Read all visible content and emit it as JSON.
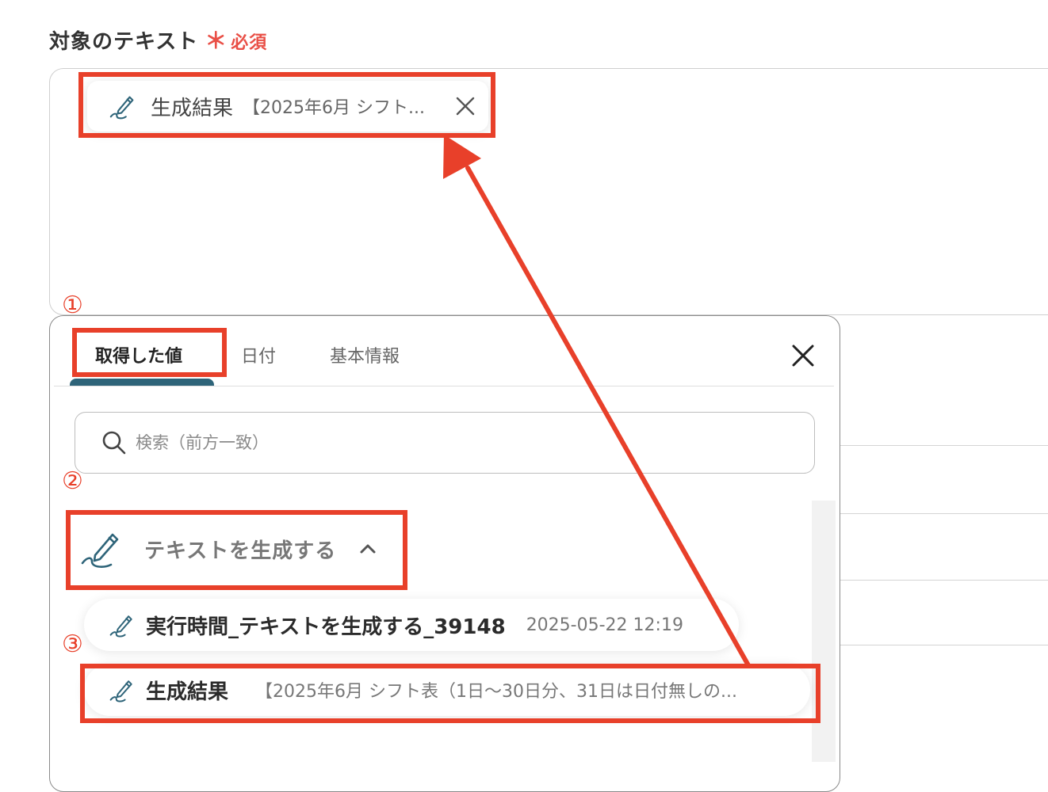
{
  "field": {
    "label": "対象のテキスト",
    "required_mark": "＊",
    "required_text": "必須"
  },
  "chip": {
    "icon": "pen-wave-icon",
    "name": "生成結果",
    "value": "【2025年6月 シフト..."
  },
  "panel": {
    "tabs": [
      {
        "label": "取得した値",
        "active": true
      },
      {
        "label": "日付",
        "active": false
      },
      {
        "label": "基本情報",
        "active": false
      }
    ],
    "search_placeholder": "検索（前方一致）",
    "group": {
      "icon": "pen-wave-icon",
      "label": "テキストを生成する",
      "expanded": true
    },
    "items": [
      {
        "name": "実行時間_テキストを生成する_39148",
        "value": "2025-05-22 12:19"
      },
      {
        "name": "生成結果",
        "value": "【2025年6月 シフト表（1日〜30日分、31日は日付無しの..."
      }
    ]
  },
  "annotations": {
    "step1": "①",
    "step2": "②",
    "step3": "③",
    "color": "#e8402a"
  }
}
